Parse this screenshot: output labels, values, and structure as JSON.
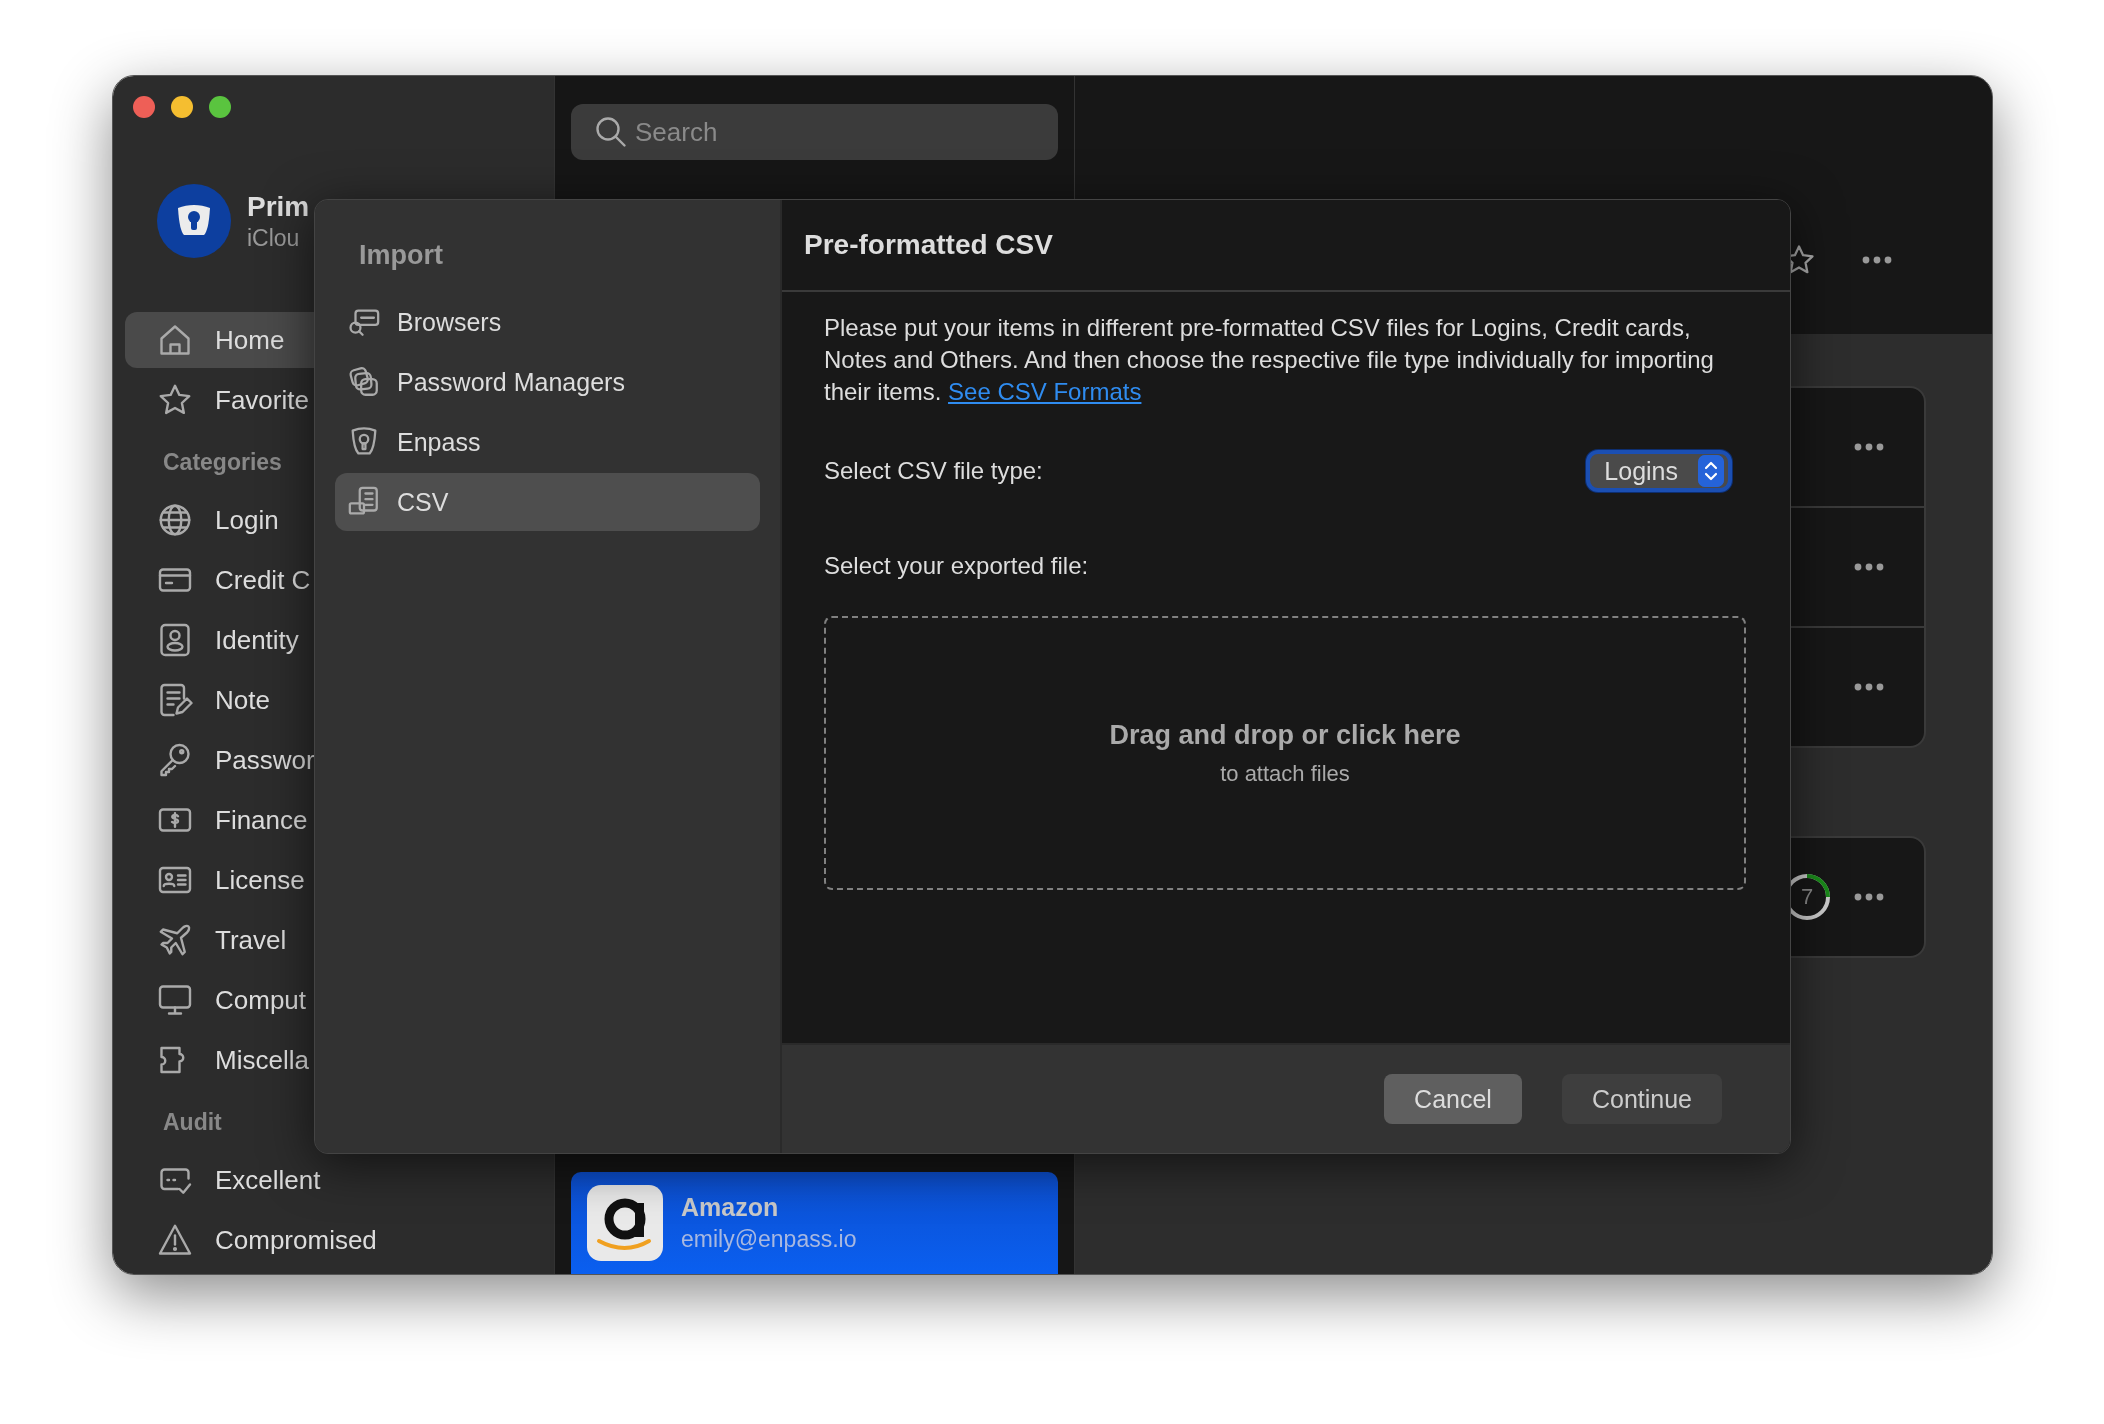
{
  "sidebar": {
    "account": {
      "name": "Prim",
      "subtitle": "iClou"
    },
    "items": [
      {
        "kind": "item",
        "label": "Home",
        "selected": true
      },
      {
        "kind": "item",
        "label": "Favorite",
        "selected": false
      },
      {
        "kind": "heading",
        "label": "Categories"
      },
      {
        "kind": "item",
        "label": "Login",
        "selected": false
      },
      {
        "kind": "item",
        "label": "Credit C",
        "selected": false
      },
      {
        "kind": "item",
        "label": "Identity",
        "selected": false
      },
      {
        "kind": "item",
        "label": "Note",
        "selected": false
      },
      {
        "kind": "item",
        "label": "Passwor",
        "selected": false
      },
      {
        "kind": "item",
        "label": "Finance",
        "selected": false
      },
      {
        "kind": "item",
        "label": "License",
        "selected": false
      },
      {
        "kind": "item",
        "label": "Travel",
        "selected": false
      },
      {
        "kind": "item",
        "label": "Comput",
        "selected": false
      },
      {
        "kind": "item",
        "label": "Miscella",
        "selected": false
      },
      {
        "kind": "heading",
        "label": "Audit"
      },
      {
        "kind": "item",
        "label": "Excellent",
        "selected": false
      },
      {
        "kind": "item",
        "label": "Compromised",
        "selected": false
      }
    ]
  },
  "list": {
    "search": {
      "placeholder": "Search"
    },
    "items": [
      {
        "title": "Amazon",
        "subtitle": "emily@enpass.io",
        "selected": true
      }
    ]
  },
  "detail": {
    "score": "7"
  },
  "dialog": {
    "sidebar": {
      "title": "Import",
      "items": [
        {
          "label": "Browsers",
          "selected": false
        },
        {
          "label": "Password Managers",
          "selected": false
        },
        {
          "label": "Enpass",
          "selected": false
        },
        {
          "label": "CSV",
          "selected": true
        }
      ]
    },
    "title": "Pre-formatted CSV",
    "description": "Please put your items in different pre-formatted CSV files for Logins, Credit cards, Notes and Others. And then choose the respective file type individually for importing their items.",
    "link": "See CSV Formats",
    "file_type": {
      "label": "Select CSV file type:",
      "value": "Logins"
    },
    "file": {
      "label": "Select your exported file:",
      "drop_title": "Drag and drop or click here",
      "drop_hint": "to attach files"
    },
    "buttons": [
      {
        "label": "Cancel",
        "default": true
      },
      {
        "label": "Continue",
        "default": false
      }
    ]
  }
}
